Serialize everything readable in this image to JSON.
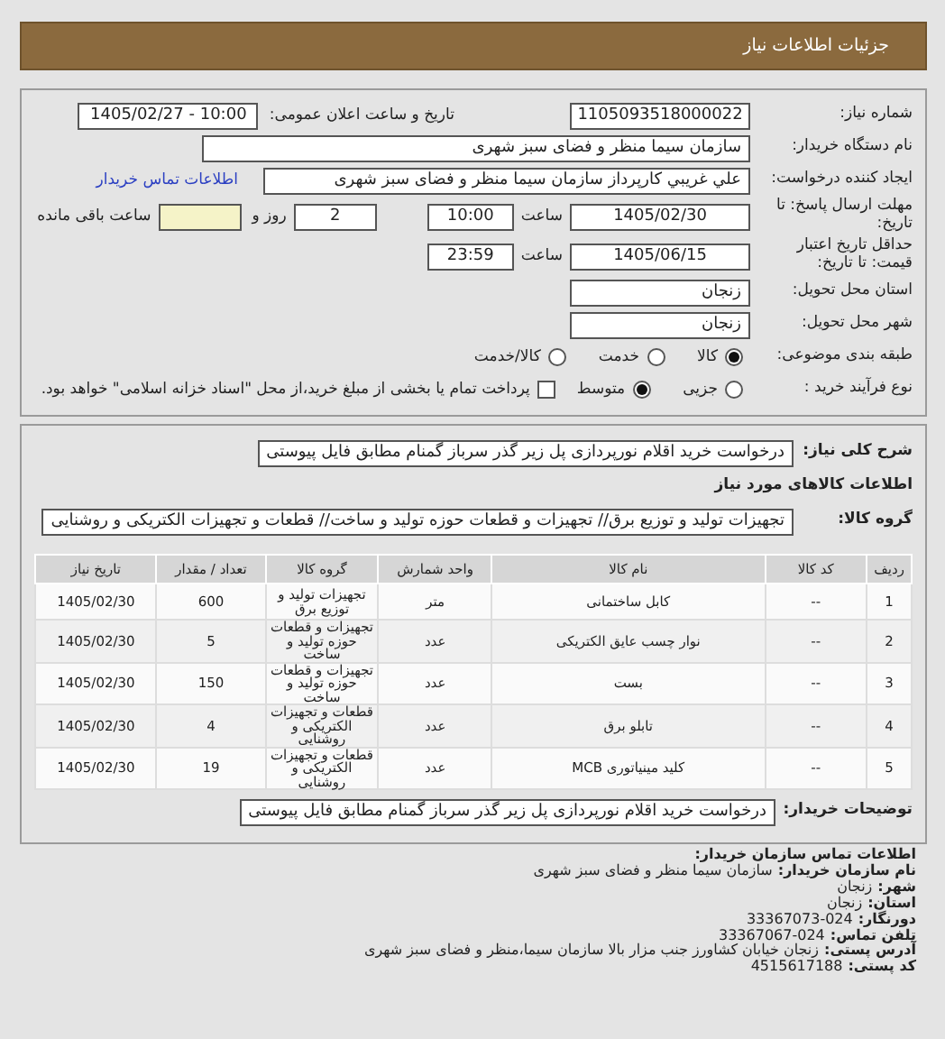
{
  "header": {
    "title": "جزئیات اطلاعات نیاز"
  },
  "need_number": {
    "label": "شماره نیاز:",
    "value": "1105093518000022"
  },
  "announce": {
    "label": "تاریخ و ساعت اعلان عمومی:",
    "value": "1405/02/27 - 10:00"
  },
  "buyer": {
    "label": "نام دستگاه خریدار:",
    "value": "سازمان سيما منظر و فضاى سبز شهرى"
  },
  "creator": {
    "label": "ایجاد کننده درخواست:",
    "value": "علي  غريبي كارپرداز  سازمان سيما منظر و فضاى سبز شهرى",
    "link": "اطلاعات تماس خریدار"
  },
  "deadline": {
    "label": "مهلت ارسال پاسخ: تا تاریخ:",
    "date": "1405/02/30",
    "time_label": "ساعت",
    "time": "10:00",
    "days": "2",
    "days_label": "روز و",
    "remaining_label": "ساعت باقی مانده"
  },
  "validity": {
    "label": "حداقل تاریخ اعتبار قیمت: تا تاریخ:",
    "date": "1405/06/15",
    "time_label": "ساعت",
    "time": "23:59"
  },
  "province": {
    "label": "استان محل تحویل:",
    "value": "زنجان"
  },
  "city": {
    "label": "شهر محل تحویل:",
    "value": "زنجان"
  },
  "category": {
    "label": "طبقه بندی موضوعی:",
    "options": [
      {
        "label": "کالا",
        "selected": true
      },
      {
        "label": "خدمت",
        "selected": false
      },
      {
        "label": "کالا/خدمت",
        "selected": false
      }
    ]
  },
  "process": {
    "label": "نوع فرآیند خرید :",
    "options": [
      {
        "label": "جزیی",
        "selected": false
      },
      {
        "label": "متوسط",
        "selected": true
      }
    ],
    "payment": {
      "checked": false,
      "text": "پرداخت تمام یا بخشی از مبلغ خرید،از محل \"اسناد خزانه اسلامی\" خواهد بود."
    }
  },
  "description": {
    "label": "شرح کلی نیاز:",
    "value": "درخواست خرید اقلام نورپردازی پل زیر گذر سرباز گمنام مطابق فایل پیوستی"
  },
  "goods_title": "اطلاعات کالاهای مورد نیاز",
  "goods_group": {
    "label": "گروه کالا:",
    "value": "تجهیزات تولید و توزیع برق// تجهیزات و قطعات حوزه تولید و ساخت// قطعات و تجهیزات الکتریکی و روشنایی"
  },
  "table": {
    "columns": [
      "ردیف",
      "کد کالا",
      "نام کالا",
      "واحد شمارش",
      "گروه کالا",
      "تعداد / مقدار",
      "تاریخ نیاز"
    ],
    "rows": [
      [
        "1",
        "--",
        "کابل ساختمانی",
        "متر",
        "تجهیزات تولید و توزیع برق",
        "600",
        "1405/02/30"
      ],
      [
        "2",
        "--",
        "نوار چسب عایق الکتریکی",
        "عدد",
        "تجهیزات و قطعات حوزه تولید و ساخت",
        "5",
        "1405/02/30"
      ],
      [
        "3",
        "--",
        "بست",
        "عدد",
        "تجهیزات و قطعات حوزه تولید و ساخت",
        "150",
        "1405/02/30"
      ],
      [
        "4",
        "--",
        "تابلو برق",
        "عدد",
        "قطعات و تجهیزات الکتریکی و روشنایی",
        "4",
        "1405/02/30"
      ],
      [
        "5",
        "--",
        "کلید مینیاتوری MCB",
        "عدد",
        "قطعات و تجهیزات الکتریکی و روشنایی",
        "19",
        "1405/02/30"
      ]
    ]
  },
  "buyer_notes": {
    "label": "توضیحات خریدار:",
    "value": "درخواست خرید اقلام نورپردازی پل زیر گذر سرباز گمنام مطابق فایل پیوستی"
  },
  "contact": {
    "title": "اطلاعات تماس سازمان خریدار:",
    "lines": [
      {
        "label": "نام سازمان خریدار:",
        "value": "سازمان سیما منظر و فضای سبز شهری"
      },
      {
        "label": "شهر:",
        "value": "زنجان"
      },
      {
        "label": "استان:",
        "value": "زنجان"
      },
      {
        "label": "دورنگار:",
        "value": "33367073-024"
      },
      {
        "label": "تلفن تماس:",
        "value": "33367067-024"
      },
      {
        "label": "آدرس پستی:",
        "value": "زنجان خیابان کشاورز جنب مزار بالا سازمان سیما،منظر و فضای سبز شهری"
      },
      {
        "label": "کد پستی:",
        "value": "4515617188"
      }
    ]
  }
}
